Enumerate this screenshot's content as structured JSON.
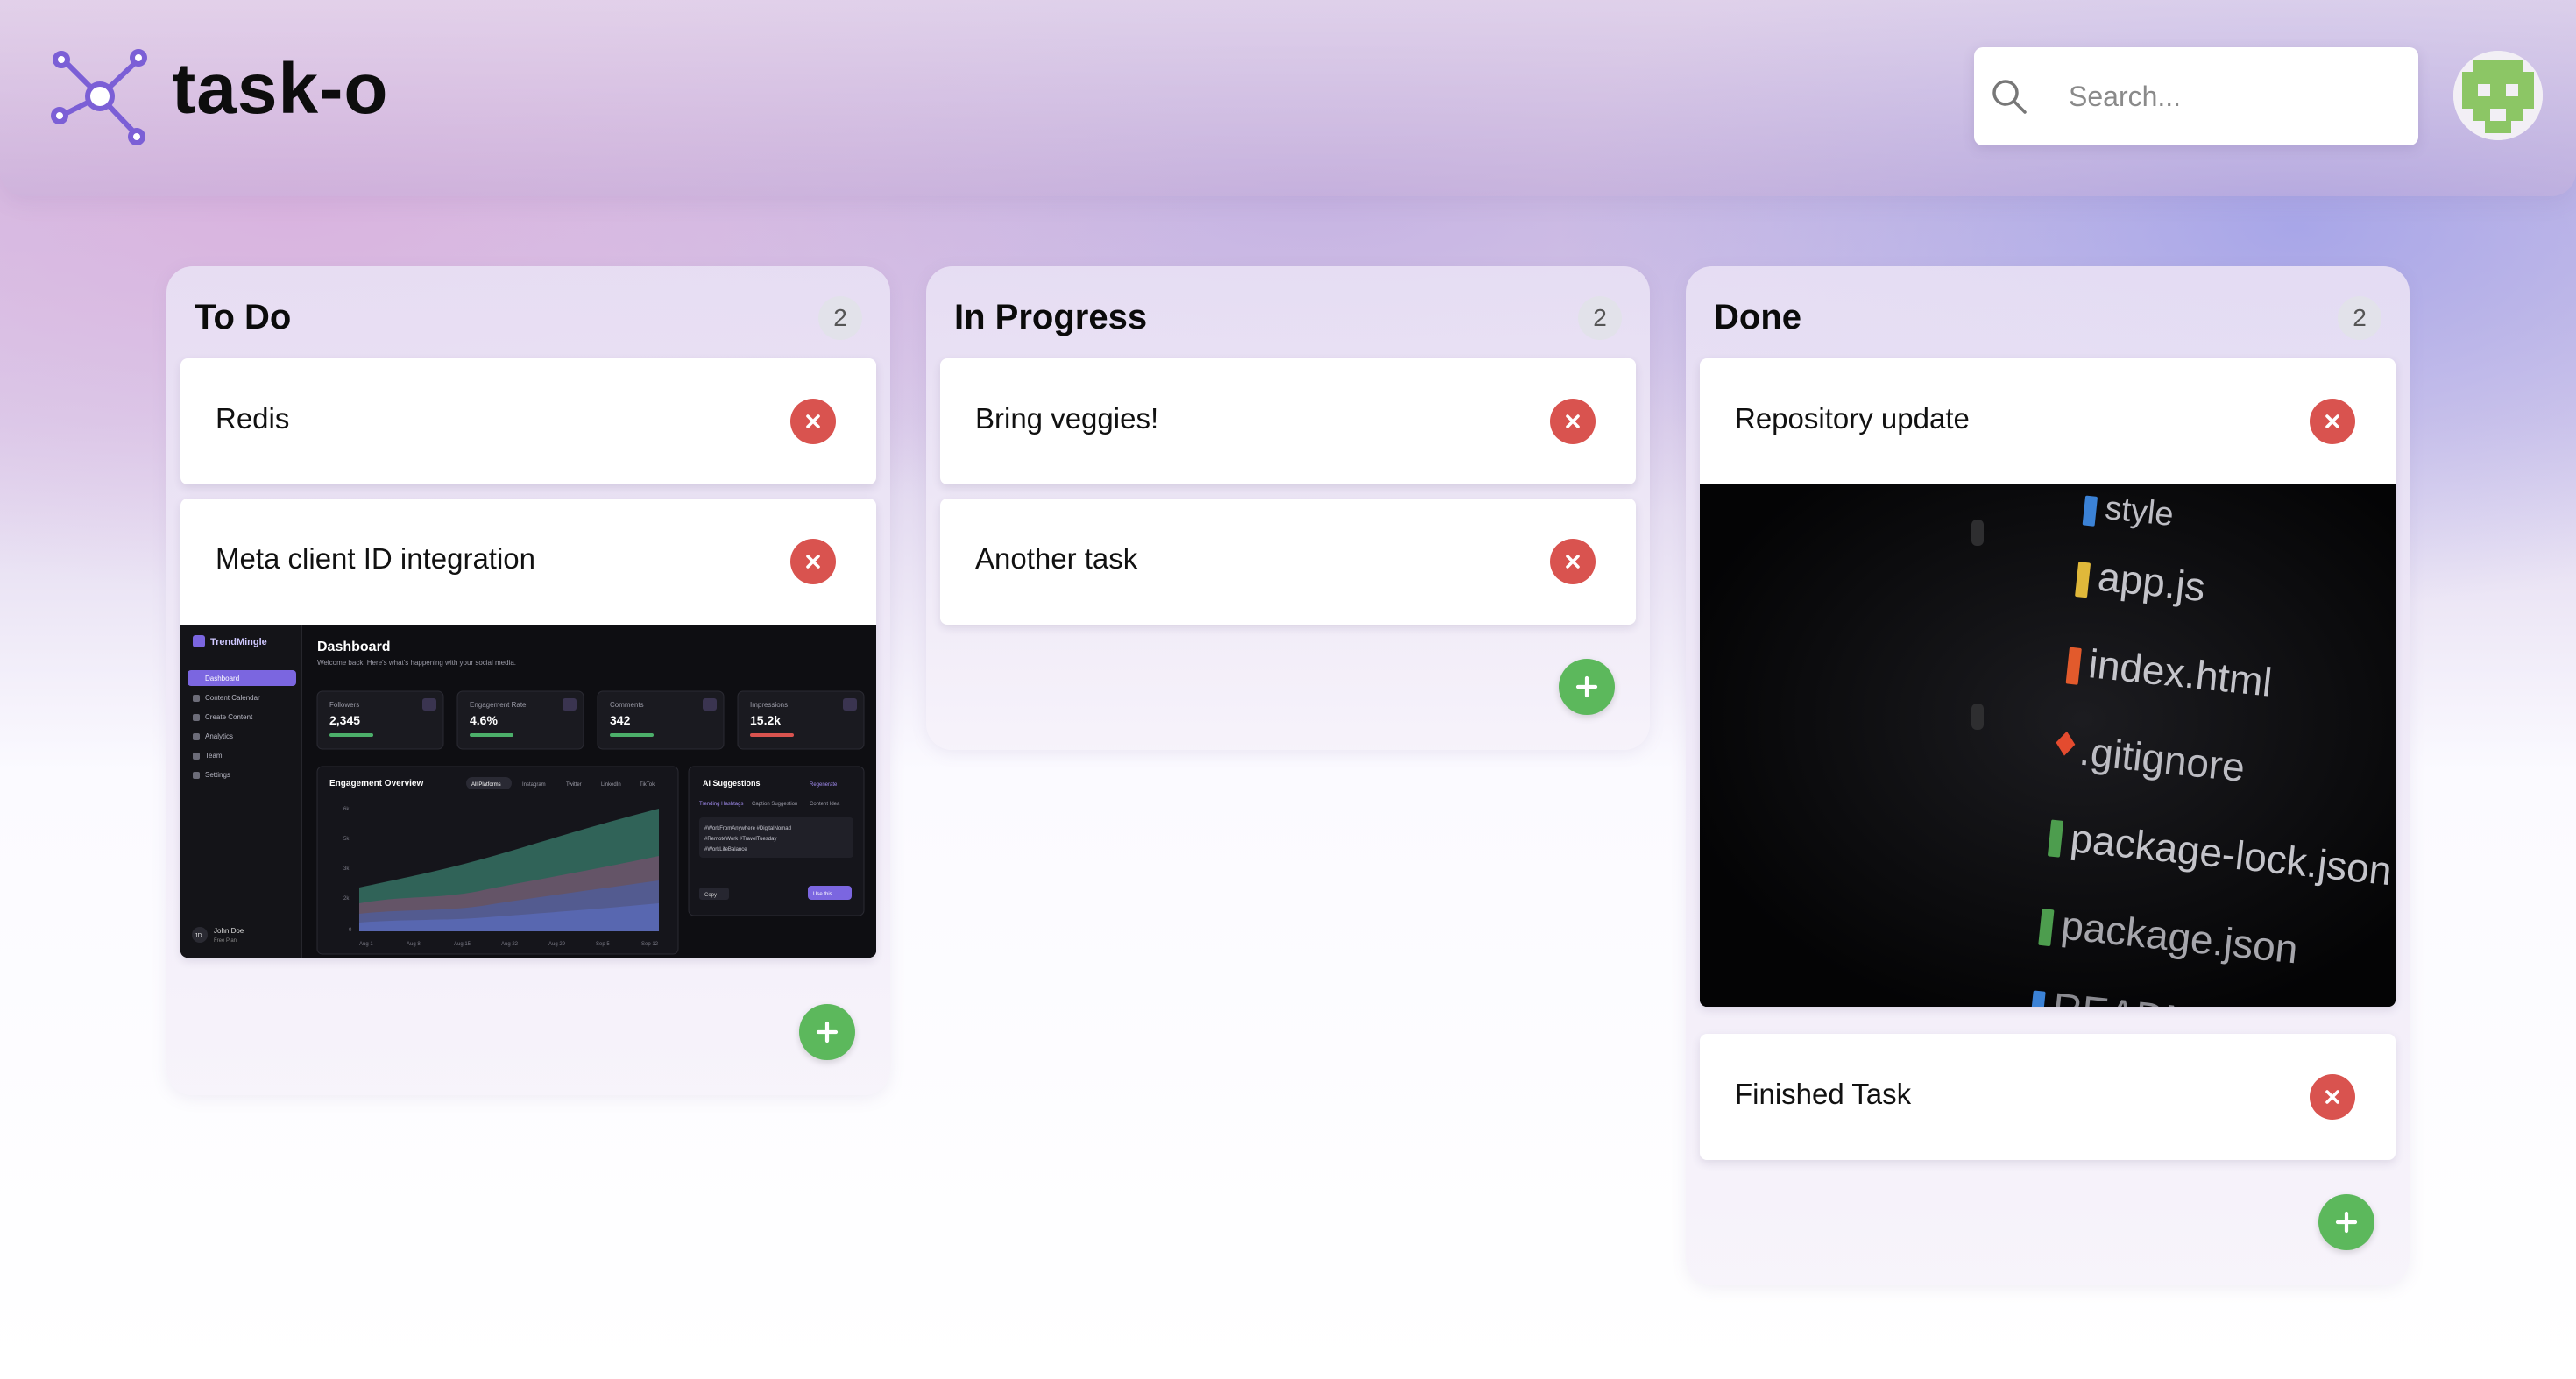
{
  "app": {
    "title": "task-o"
  },
  "search": {
    "placeholder": "Search..."
  },
  "columns": [
    {
      "title": "To Do",
      "count": "2",
      "cards": [
        {
          "title": "Redis"
        },
        {
          "title": "Meta client ID integration",
          "cover": {
            "brand": "TrendMingle",
            "heading": "Dashboard",
            "subheading": "Welcome back! Here's what's happening with your social media.",
            "nav": [
              "Dashboard",
              "Content Calendar",
              "Create Content",
              "Analytics",
              "Team",
              "Settings"
            ],
            "stats": [
              {
                "label": "Followers",
                "value": "2,345"
              },
              {
                "label": "Engagement Rate",
                "value": "4.6%"
              },
              {
                "label": "Comments",
                "value": "342"
              },
              {
                "label": "Impressions",
                "value": "15.2k"
              }
            ],
            "chart_title": "Engagement Overview",
            "chart_tabs": [
              "All Platforms",
              "Instagram",
              "Twitter",
              "LinkedIn",
              "TikTok"
            ],
            "x_ticks": [
              "Aug 1",
              "Aug 8",
              "Aug 15",
              "Aug 22",
              "Aug 29",
              "Sep 5",
              "Sep 12"
            ],
            "y_ticks": [
              "6k",
              "5k",
              "3k",
              "2k",
              "0"
            ],
            "ai_title": "AI Suggestions",
            "ai_link": "Regenerate",
            "ai_tabs": [
              "Trending Hashtags",
              "Caption Suggestion",
              "Content Idea"
            ],
            "ai_text": [
              "#WorkFromAnywhere #DigitalNomad",
              "#RemoteWork #TravelTuesday",
              "#WorkLifeBalance"
            ],
            "ai_copy": "Copy",
            "ai_use": "Use this",
            "user_name": "John Doe",
            "user_plan": "Free Plan",
            "user_initials": "JD"
          }
        }
      ]
    },
    {
      "title": "In Progress",
      "count": "2",
      "cards": [
        {
          "title": "Bring veggies!"
        },
        {
          "title": "Another task"
        }
      ]
    },
    {
      "title": "Done",
      "count": "2",
      "cards": [
        {
          "title": "Repository update",
          "cover": {
            "files": [
              "style",
              "app.js",
              "index.html",
              ".gitignore",
              "package-lock.json",
              "package.json",
              "README"
            ]
          }
        },
        {
          "title": "Finished Task"
        }
      ]
    }
  ],
  "colors": {
    "accent": "#7b5fd6",
    "delete": "#d9534f",
    "add": "#5cb85c"
  },
  "icons": {
    "logo": "network-nodes-icon",
    "search": "search-icon",
    "avatar": "pixel-avatar-icon",
    "delete": "close-icon",
    "add": "plus-icon"
  }
}
